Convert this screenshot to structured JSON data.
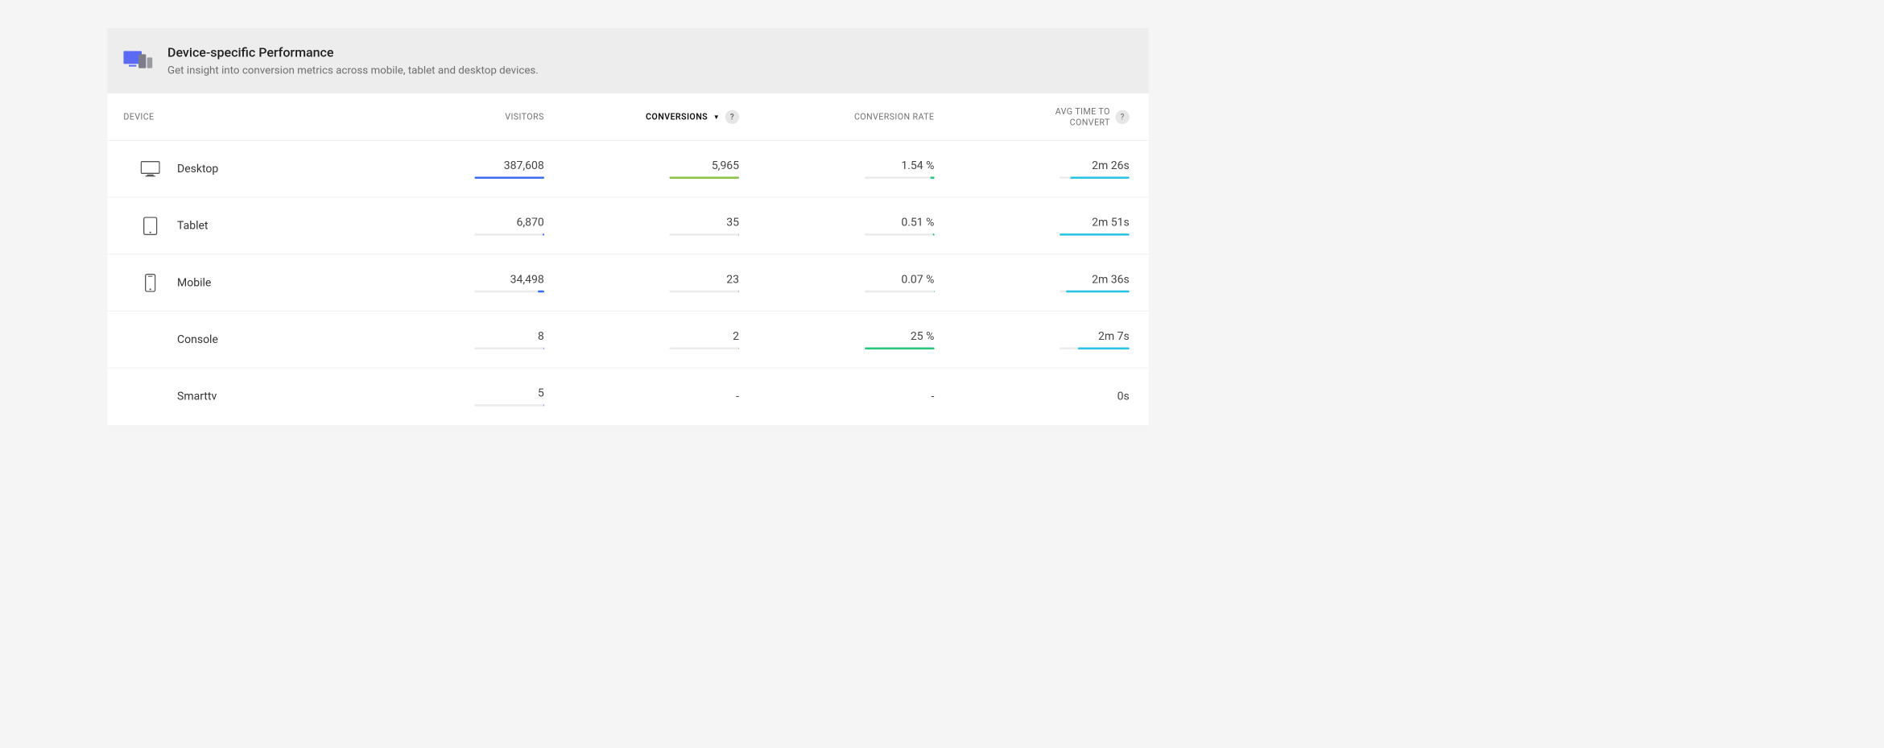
{
  "header": {
    "title": "Device-specific Performance",
    "subtitle": "Get insight into conversion metrics across mobile, tablet and desktop devices."
  },
  "columns": {
    "device": "DEVICE",
    "visitors": "VISITORS",
    "conversions": "CONVERSIONS",
    "conversion_rate": "CONVERSION RATE",
    "avg_time_line1": "AVG TIME TO",
    "avg_time_line2": "CONVERT",
    "sort_caret": "▼",
    "help": "?"
  },
  "colors": {
    "visitors": "#3b6df4",
    "conversions": "#8bc34a",
    "conversion_rate": "#29c77a",
    "avg_time": "#29c3e6",
    "track": "#ececec"
  },
  "rows": [
    {
      "icon": "desktop",
      "name": "Desktop",
      "visitors": {
        "text": "387,608",
        "pct": 100
      },
      "conversions": {
        "text": "5,965",
        "pct": 100
      },
      "rate": {
        "text": "1.54 %",
        "pct": 6
      },
      "time": {
        "text": "2m 26s",
        "pct": 85
      }
    },
    {
      "icon": "tablet",
      "name": "Tablet",
      "visitors": {
        "text": "6,870",
        "pct": 2
      },
      "conversions": {
        "text": "35",
        "pct": 1
      },
      "rate": {
        "text": "0.51 %",
        "pct": 2
      },
      "time": {
        "text": "2m 51s",
        "pct": 100
      }
    },
    {
      "icon": "mobile",
      "name": "Mobile",
      "visitors": {
        "text": "34,498",
        "pct": 9
      },
      "conversions": {
        "text": "23",
        "pct": 0.5
      },
      "rate": {
        "text": "0.07 %",
        "pct": 0.3
      },
      "time": {
        "text": "2m 36s",
        "pct": 91
      }
    },
    {
      "icon": "",
      "name": "Console",
      "visitors": {
        "text": "8",
        "pct": 0.1
      },
      "conversions": {
        "text": "2",
        "pct": 0.1
      },
      "rate": {
        "text": "25 %",
        "pct": 100
      },
      "time": {
        "text": "2m 7s",
        "pct": 74
      }
    },
    {
      "icon": "",
      "name": "Smarttv",
      "visitors": {
        "text": "5",
        "pct": 0.1
      },
      "conversions": {
        "text": "-",
        "pct": null
      },
      "rate": {
        "text": "-",
        "pct": null
      },
      "time": {
        "text": "0s",
        "pct": null
      }
    }
  ]
}
